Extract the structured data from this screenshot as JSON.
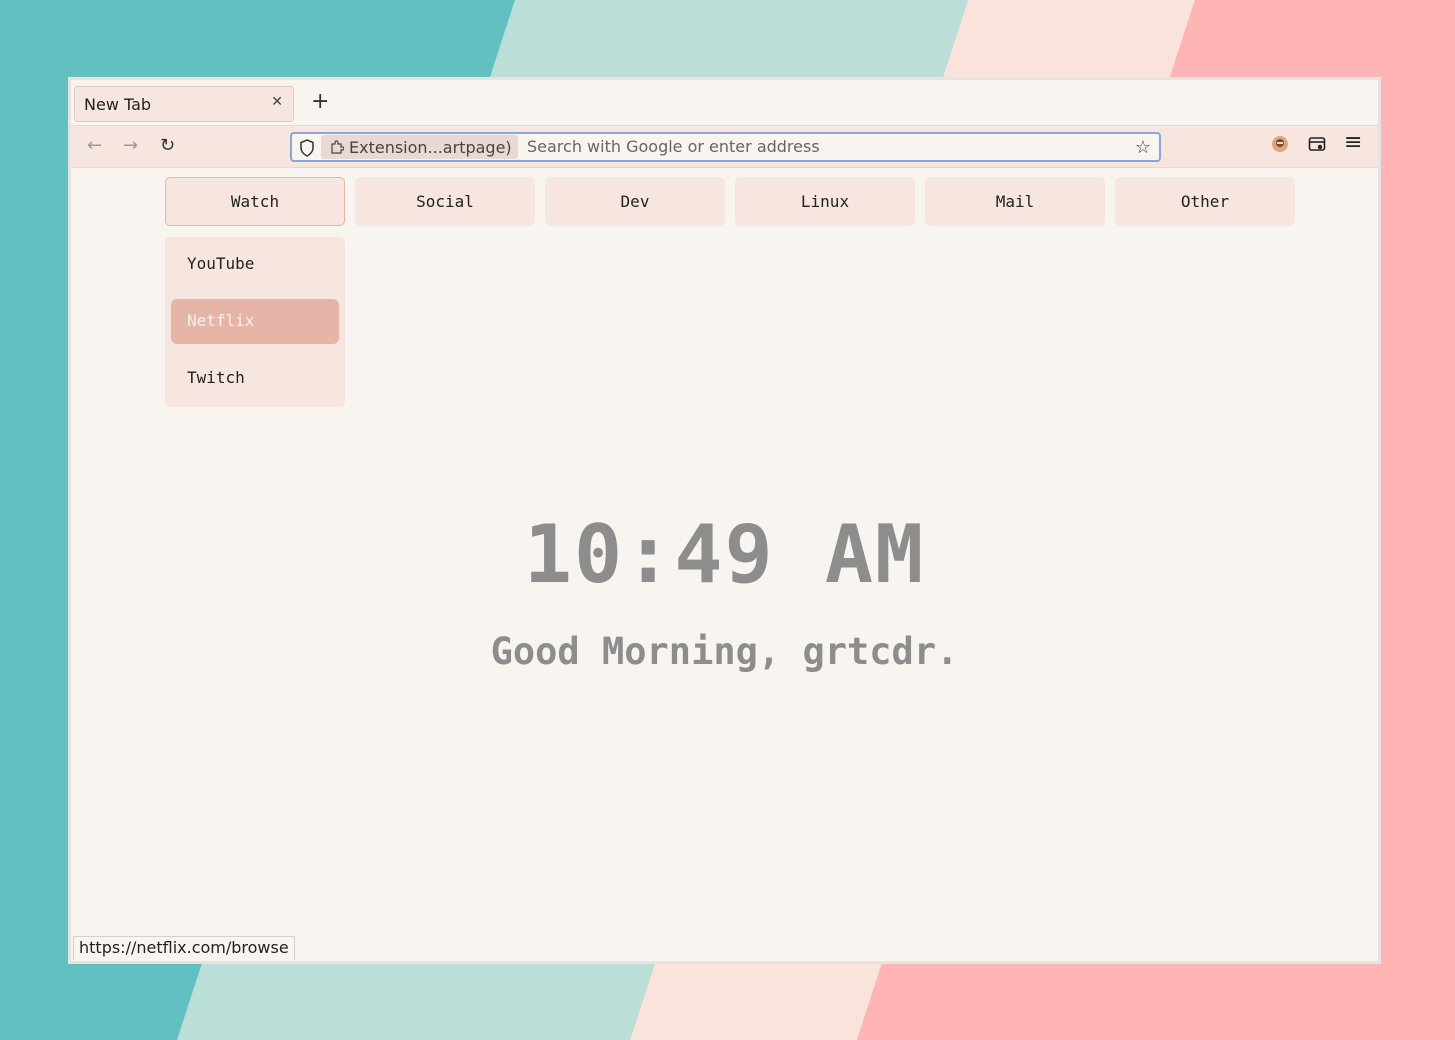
{
  "wallpaper": {
    "colors": [
      "#63c0c0",
      "#bbdfd8",
      "#fae3da",
      "#ffb5b6"
    ]
  },
  "browser": {
    "tab": {
      "title": "New Tab",
      "close_icon": "close-icon"
    },
    "new_tab_icon": "plus-icon",
    "nav": {
      "back": "←",
      "forward": "→",
      "reload": "↻"
    },
    "urlbar": {
      "identity_label": "Extension...artpage)",
      "placeholder": "Search with Google or enter address",
      "bookmark_icon": "☆"
    },
    "toolbar_icons": [
      "extension-avatar-icon",
      "tab-manager-icon",
      "menu-icon"
    ],
    "menu_glyph": "≡"
  },
  "startpage": {
    "categories": [
      "Watch",
      "Social",
      "Dev",
      "Linux",
      "Mail",
      "Other"
    ],
    "active_category": "Watch",
    "dropdown_items": [
      "YouTube",
      "Netflix",
      "Twitch"
    ],
    "hovered_item": "Netflix",
    "clock": "10:49 AM",
    "greeting": "Good Morning, grtcdr."
  },
  "status_url": "https://netflix.com/browse",
  "colors": {
    "accent": "#e7b5a7",
    "button_bg": "#f6e6df",
    "page_bg": "#f8f4ef",
    "text_muted": "#8d8d8d"
  }
}
